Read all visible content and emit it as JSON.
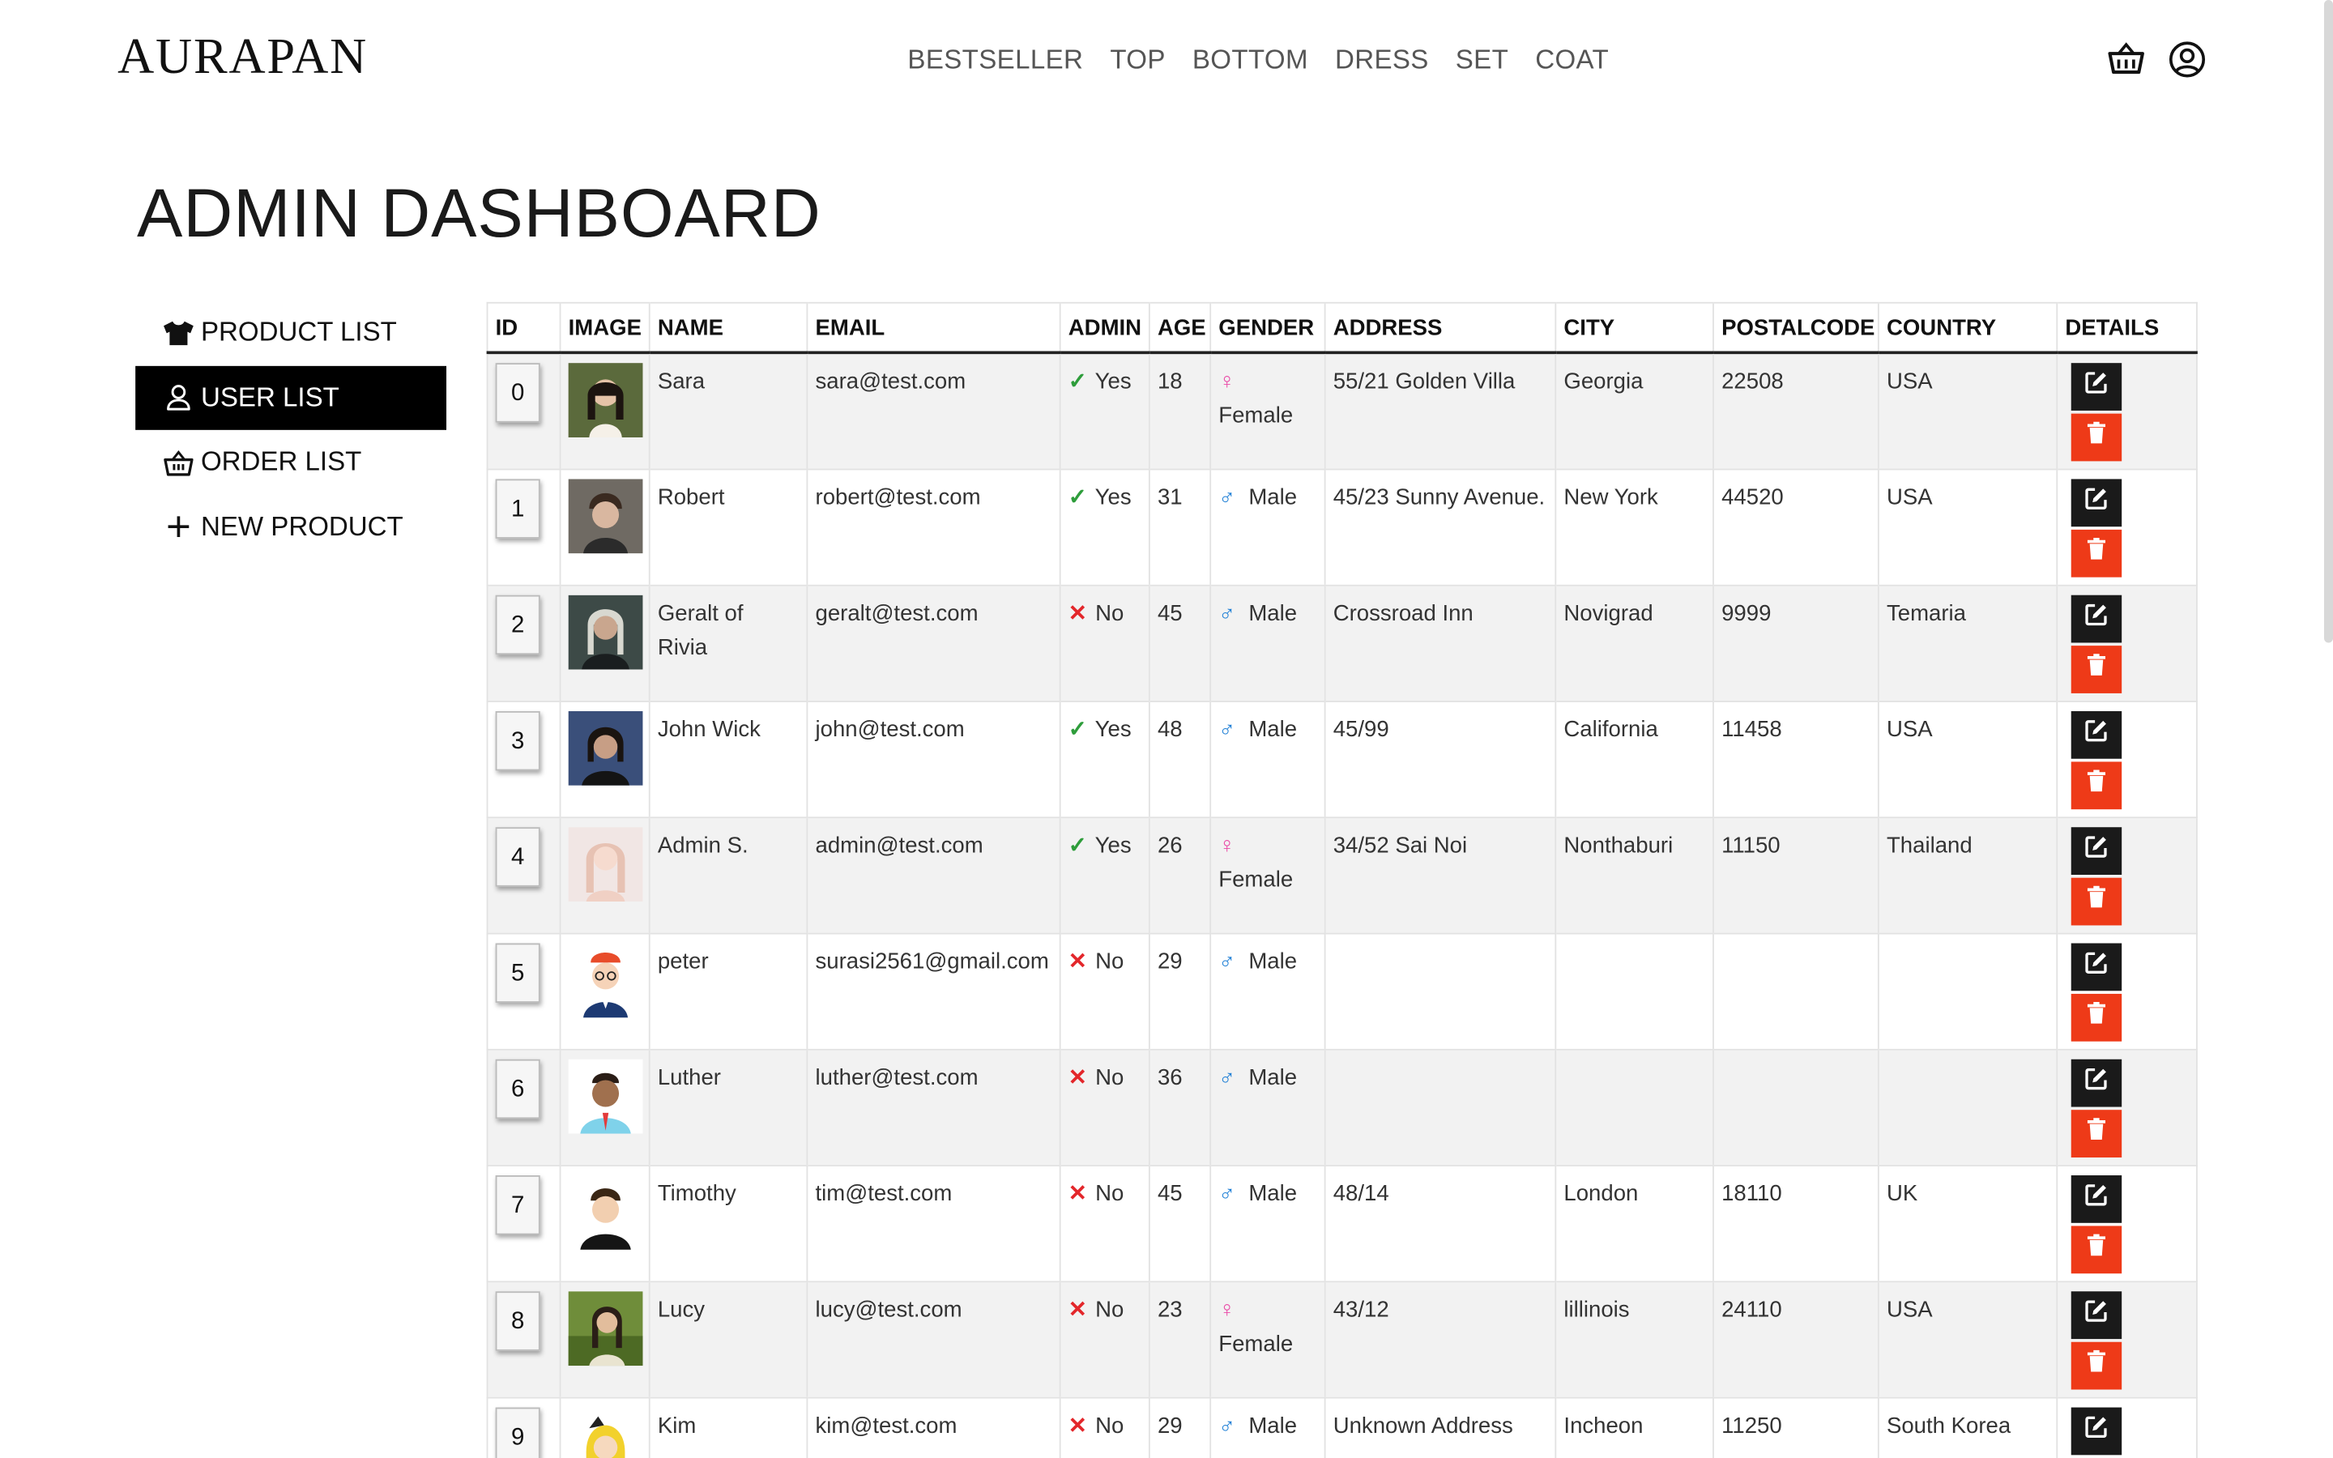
{
  "brand": {
    "logo": "AURAPAN"
  },
  "nav": [
    "BESTSELLER",
    "TOP",
    "BOTTOM",
    "DRESS",
    "SET",
    "COAT"
  ],
  "header_icons": [
    "basket-icon",
    "user-circle-icon"
  ],
  "page": {
    "title": "ADMIN DASHBOARD"
  },
  "sidebar": {
    "items": [
      {
        "label": "PRODUCT LIST",
        "icon": "tshirt-icon",
        "active": false
      },
      {
        "label": "USER LIST",
        "icon": "user-icon",
        "active": true
      },
      {
        "label": "ORDER LIST",
        "icon": "basket-icon",
        "active": false
      },
      {
        "label": "NEW PRODUCT",
        "icon": "plus-icon",
        "active": false
      }
    ]
  },
  "table": {
    "headers": [
      "ID",
      "IMAGE",
      "NAME",
      "EMAIL",
      "ADMIN",
      "AGE",
      "GENDER",
      "ADDRESS",
      "CITY",
      "POSTALCODE",
      "COUNTRY",
      "DETAILS"
    ],
    "rows": [
      {
        "id": "0",
        "avatar": "photo-woman",
        "name": "Sara",
        "email": "sara@test.com",
        "admin": "Yes",
        "age": "18",
        "gender": "Female",
        "address": "55/21 Golden Villa",
        "city": "Georgia",
        "postalcode": "22508",
        "country": "USA"
      },
      {
        "id": "1",
        "avatar": "photo-man",
        "name": "Robert",
        "email": "robert@test.com",
        "admin": "Yes",
        "age": "31",
        "gender": "Male",
        "address": "45/23 Sunny Avenue.",
        "city": "New York",
        "postalcode": "44520",
        "country": "USA"
      },
      {
        "id": "2",
        "avatar": "photo-warrior",
        "name": "Geralt of Rivia",
        "email": "geralt@test.com",
        "admin": "No",
        "age": "45",
        "gender": "Male",
        "address": "Crossroad Inn",
        "city": "Novigrad",
        "postalcode": "9999",
        "country": "Temaria"
      },
      {
        "id": "3",
        "avatar": "photo-man-dark",
        "name": "John Wick",
        "email": "john@test.com",
        "admin": "Yes",
        "age": "48",
        "gender": "Male",
        "address": "45/99",
        "city": "California",
        "postalcode": "11458",
        "country": "USA"
      },
      {
        "id": "4",
        "avatar": "photo-woman-light",
        "name": "Admin S.",
        "email": "admin@test.com",
        "admin": "Yes",
        "age": "26",
        "gender": "Female",
        "address": "34/52 Sai Noi",
        "city": "Nonthaburi",
        "postalcode": "11150",
        "country": "Thailand"
      },
      {
        "id": "5",
        "avatar": "cartoon-man-redcap",
        "name": "peter",
        "email": "surasi2561@gmail.com",
        "admin": "No",
        "age": "29",
        "gender": "Male",
        "address": "",
        "city": "",
        "postalcode": "",
        "country": ""
      },
      {
        "id": "6",
        "avatar": "cartoon-man-blue",
        "name": "Luther",
        "email": "luther@test.com",
        "admin": "No",
        "age": "36",
        "gender": "Male",
        "address": "",
        "city": "",
        "postalcode": "",
        "country": ""
      },
      {
        "id": "7",
        "avatar": "cartoon-man-black",
        "name": "Timothy",
        "email": "tim@test.com",
        "admin": "No",
        "age": "45",
        "gender": "Male",
        "address": "48/14",
        "city": "London",
        "postalcode": "18110",
        "country": "UK"
      },
      {
        "id": "8",
        "avatar": "photo-woman-outdoor",
        "name": "Lucy",
        "email": "lucy@test.com",
        "admin": "No",
        "age": "23",
        "gender": "Female",
        "address": "43/12",
        "city": "lillinois",
        "postalcode": "24110",
        "country": "USA"
      },
      {
        "id": "9",
        "avatar": "cartoon-yellow",
        "name": "Kim",
        "email": "kim@test.com",
        "admin": "No",
        "age": "29",
        "gender": "Male",
        "address": "Unknown Address",
        "city": "Incheon",
        "postalcode": "11250",
        "country": "South Korea"
      }
    ]
  },
  "colors": {
    "accent": "#000000",
    "yes": "#2e9d3b",
    "no": "#e3272b",
    "female": "#ea4aa7",
    "male": "#1e7fd6",
    "edit_button": "#1a1a1a",
    "delete_button": "#ee3a18",
    "row_stripe": "#f2f2f2"
  }
}
